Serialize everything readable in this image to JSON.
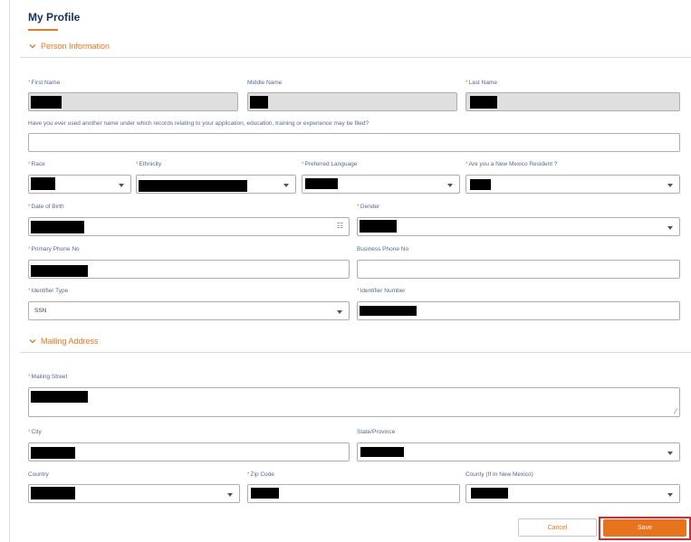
{
  "page": {
    "title": "My Profile"
  },
  "sections": {
    "person": {
      "label": "Person Information"
    },
    "mailing": {
      "label": "Mailing Address"
    }
  },
  "fields": {
    "first_name": {
      "label": "First Name",
      "required": "*"
    },
    "middle_name": {
      "label": "Middle Name"
    },
    "last_name": {
      "label": "Last Name",
      "required": "*"
    },
    "other_name": {
      "label": "Have you ever used another name under which records relating to your application, education, training or experience may be filed?",
      "value": ""
    },
    "race": {
      "label": "Race",
      "required": "*"
    },
    "ethnicity": {
      "label": "Ethnicity",
      "required": "*"
    },
    "preferred_language": {
      "label": "Preferred Language",
      "required": "*"
    },
    "nm_resident": {
      "label": "Are you a New Mexico Resident ?",
      "required": "*"
    },
    "dob": {
      "label": "Date of Birth",
      "required": "*"
    },
    "gender": {
      "label": "Gender",
      "required": "*"
    },
    "primary_phone": {
      "label": "Primary Phone No",
      "required": "*"
    },
    "business_phone": {
      "label": "Business Phone No",
      "value": ""
    },
    "identifier_type": {
      "label": "Identifier Type",
      "required": "*",
      "value": "SSN"
    },
    "identifier_number": {
      "label": "Identifier Number",
      "required": "*"
    },
    "mailing_street": {
      "label": "Mailing Street",
      "required": "*"
    },
    "city": {
      "label": "City",
      "required": "*"
    },
    "state": {
      "label": "State/Province"
    },
    "country": {
      "label": "Country"
    },
    "zip": {
      "label": "Zip Code",
      "required": "*"
    },
    "county": {
      "label": "County (If In New Mexico)"
    }
  },
  "buttons": {
    "cancel": "Cancel",
    "save": "Save"
  },
  "colors": {
    "accent": "#e87722",
    "highlight": "#e0262b",
    "readonly": "#dfdfdf"
  },
  "icons": {
    "section_toggle": "chevron-down-icon",
    "dropdown": "caret-down-icon",
    "date": "calendar-icon",
    "resize": "resize-handle-icon"
  }
}
